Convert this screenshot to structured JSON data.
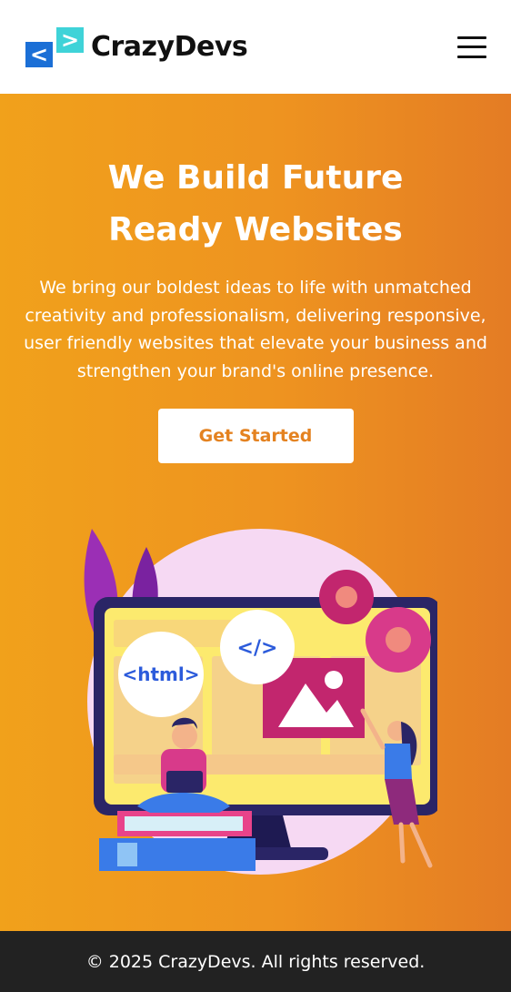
{
  "header": {
    "brand_name": "CrazyDevs",
    "logo_glyph_left": "<",
    "logo_glyph_right": ">"
  },
  "hero": {
    "title": "We Build Future Ready Websites",
    "description": "We bring our boldest ideas to life with unmatched creativity and professionalism, delivering responsive, user friendly websites that elevate your business and strengthen your brand's online presence.",
    "cta_label": "Get Started",
    "illustration": {
      "html_badge": "<html>",
      "code_badge": "</>"
    }
  },
  "footer": {
    "copyright": "© 2025 CrazyDevs. All rights reserved."
  },
  "colors": {
    "brand_blue": "#1B6FD6",
    "brand_cyan": "#3FD3D8",
    "hero_orange": "#EE9320",
    "cta_text": "#E48220",
    "footer_bg": "#222222"
  },
  "icons": {
    "menu": "hamburger-icon",
    "logo": "code-brackets-logo"
  }
}
